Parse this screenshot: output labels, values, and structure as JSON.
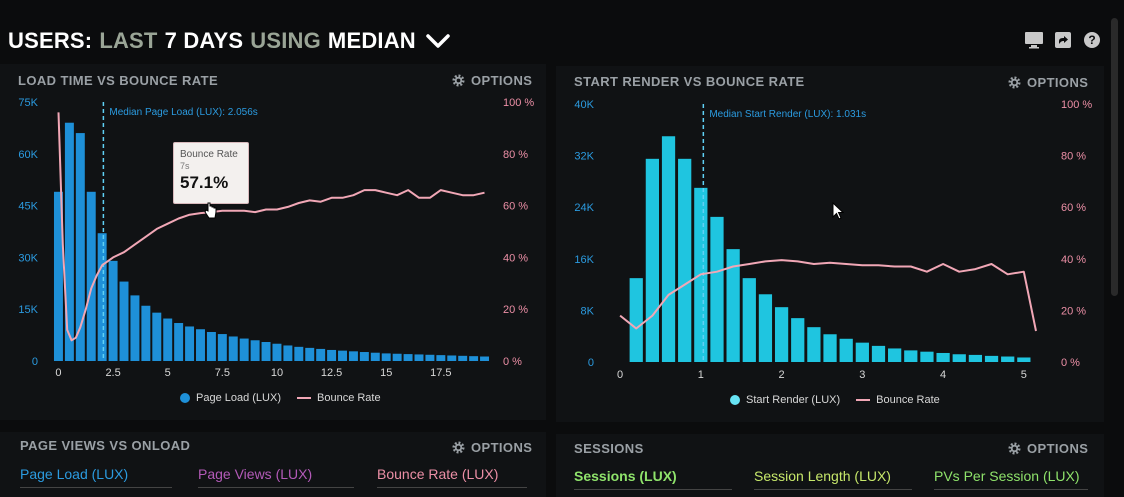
{
  "header": {
    "w1": "USERS:",
    "w2": "LAST",
    "w3": "7 DAYS",
    "w4": "USING",
    "w5": "MEDIAN",
    "dropdown_icon": "chevron-down-icon"
  },
  "top_icons": [
    "monitor-icon",
    "share-icon",
    "help-icon"
  ],
  "colors": {
    "bar_blue": "#1e90d8",
    "bar_cyan": "#1fc5e0",
    "bounce": "#f1a7b6",
    "accent_pink": "#ec8fa6",
    "green": "#8fe36b",
    "tab_blue": "#2b9be0",
    "tab_purple": "#b35ab8"
  },
  "panels": {
    "p1": {
      "title": "LOAD TIME VS BOUNCE RATE",
      "options": "OPTIONS",
      "median_label": "Median Page Load (LUX): 2.056s",
      "legend": [
        "Page Load (LUX)",
        "Bounce Rate"
      ],
      "tooltip": {
        "title": "Bounce Rate",
        "sub": "7s",
        "value": "57.1%"
      }
    },
    "p2": {
      "title": "START RENDER VS BOUNCE RATE",
      "options": "OPTIONS",
      "median_label": "Median Start Render (LUX): 1.031s",
      "legend": [
        "Start Render (LUX)",
        "Bounce Rate"
      ]
    },
    "p3": {
      "title": "PAGE VIEWS VS ONLOAD",
      "options": "OPTIONS",
      "tabs": [
        "Page Load (LUX)",
        "Page Views (LUX)",
        "Bounce Rate (LUX)"
      ]
    },
    "p4": {
      "title": "SESSIONS",
      "options": "OPTIONS",
      "tabs": [
        "Sessions (LUX)",
        "Session Length (LUX)",
        "PVs Per Session (LUX)"
      ]
    }
  },
  "chart_data": [
    {
      "type": "bar",
      "x_tick_labels": [
        "0",
        "2.5",
        "5",
        "7.5",
        "10",
        "12.5",
        "15",
        "17.5"
      ],
      "x_tick_values": [
        0,
        2.5,
        5,
        7.5,
        10,
        12.5,
        15,
        17.5
      ],
      "y_left_tick_labels": [
        "75K",
        "60K",
        "45K",
        "30K",
        "15K",
        "0"
      ],
      "y_right_tick_labels": [
        "100 %",
        "80 %",
        "60 %",
        "40 %",
        "20 %",
        "0 %"
      ],
      "xlim": [
        -0.25,
        19.75
      ],
      "ylim_left": [
        0,
        75000
      ],
      "ylim_right": [
        0,
        100
      ],
      "median": 2.056,
      "series": [
        {
          "name": "Page Load (LUX)",
          "axis": "left",
          "bar_width": 0.5,
          "x": [
            0,
            0.5,
            1,
            1.5,
            2,
            2.5,
            3,
            3.5,
            4,
            4.5,
            5,
            5.5,
            6,
            6.5,
            7,
            7.5,
            8,
            8.5,
            9,
            9.5,
            10,
            10.5,
            11,
            11.5,
            12,
            12.5,
            13,
            13.5,
            14,
            14.5,
            15,
            15.5,
            16,
            16.5,
            17,
            17.5,
            18,
            18.5,
            19,
            19.5
          ],
          "values": [
            49000,
            69000,
            66000,
            49000,
            37000,
            29000,
            23000,
            19000,
            16000,
            14000,
            12300,
            11000,
            10000,
            9200,
            8400,
            7800,
            7100,
            6500,
            6000,
            5500,
            5000,
            4500,
            4100,
            3800,
            3500,
            3200,
            3000,
            2800,
            2600,
            2400,
            2200,
            2100,
            2000,
            1900,
            1800,
            1700,
            1600,
            1500,
            1400,
            1300
          ]
        },
        {
          "name": "Bounce Rate",
          "axis": "right",
          "type": "line",
          "x": [
            0,
            0.2,
            0.4,
            0.6,
            0.8,
            1,
            1.25,
            1.5,
            1.75,
            2,
            2.5,
            3,
            3.5,
            4,
            4.5,
            5,
            5.5,
            6,
            6.5,
            7,
            7.5,
            8,
            8.5,
            9,
            9.5,
            10,
            10.5,
            11,
            11.5,
            12,
            12.5,
            13,
            13.5,
            14,
            14.5,
            15,
            15.5,
            16,
            16.5,
            17,
            17.5,
            18,
            18.5,
            19,
            19.5
          ],
          "values": [
            96,
            45,
            12,
            8,
            9,
            13,
            20,
            28,
            33,
            37,
            40,
            42,
            45,
            48,
            51,
            53,
            55,
            56.5,
            57.1,
            57.5,
            58,
            58,
            58,
            57.5,
            58.5,
            58.5,
            59.5,
            61,
            62,
            61.5,
            63,
            63,
            64,
            66,
            66,
            65,
            64,
            66,
            63,
            63,
            66,
            65,
            64,
            64,
            65
          ]
        }
      ]
    },
    {
      "type": "bar",
      "x_tick_labels": [
        "0",
        "1",
        "2",
        "3",
        "4",
        "5"
      ],
      "x_tick_values": [
        0,
        1,
        2,
        3,
        4,
        5
      ],
      "y_left_tick_labels": [
        "40K",
        "32K",
        "24K",
        "16K",
        "8K",
        "0"
      ],
      "y_right_tick_labels": [
        "100 %",
        "80 %",
        "60 %",
        "40 %",
        "20 %",
        "0 %"
      ],
      "xlim": [
        -0.1,
        5.2
      ],
      "ylim_left": [
        0,
        40000
      ],
      "ylim_right": [
        0,
        100
      ],
      "median": 1.031,
      "series": [
        {
          "name": "Start Render (LUX)",
          "axis": "left",
          "bar_width": 0.2,
          "x": [
            0.2,
            0.4,
            0.6,
            0.8,
            1,
            1.2,
            1.4,
            1.6,
            1.8,
            2,
            2.2,
            2.4,
            2.6,
            2.8,
            3,
            3.2,
            3.4,
            3.6,
            3.8,
            4,
            4.2,
            4.4,
            4.6,
            4.8,
            5
          ],
          "values": [
            13000,
            31500,
            35000,
            31500,
            27000,
            22500,
            17500,
            13000,
            10500,
            8500,
            6800,
            5400,
            4300,
            3600,
            3000,
            2500,
            2100,
            1800,
            1600,
            1400,
            1200,
            1100,
            950,
            850,
            700
          ]
        },
        {
          "name": "Bounce Rate",
          "axis": "right",
          "type": "line",
          "x": [
            0,
            0.2,
            0.4,
            0.6,
            0.8,
            1,
            1.2,
            1.4,
            1.6,
            1.8,
            2,
            2.2,
            2.4,
            2.6,
            2.8,
            3,
            3.2,
            3.4,
            3.6,
            3.8,
            4,
            4.2,
            4.4,
            4.6,
            4.8,
            5,
            5.15
          ],
          "values": [
            18,
            13,
            18,
            26,
            30,
            34,
            35,
            37,
            38,
            39,
            39.5,
            39,
            38,
            38.5,
            38,
            37.5,
            37.5,
            37,
            37,
            35,
            38,
            35,
            36,
            38,
            34,
            35,
            12
          ]
        }
      ]
    }
  ]
}
